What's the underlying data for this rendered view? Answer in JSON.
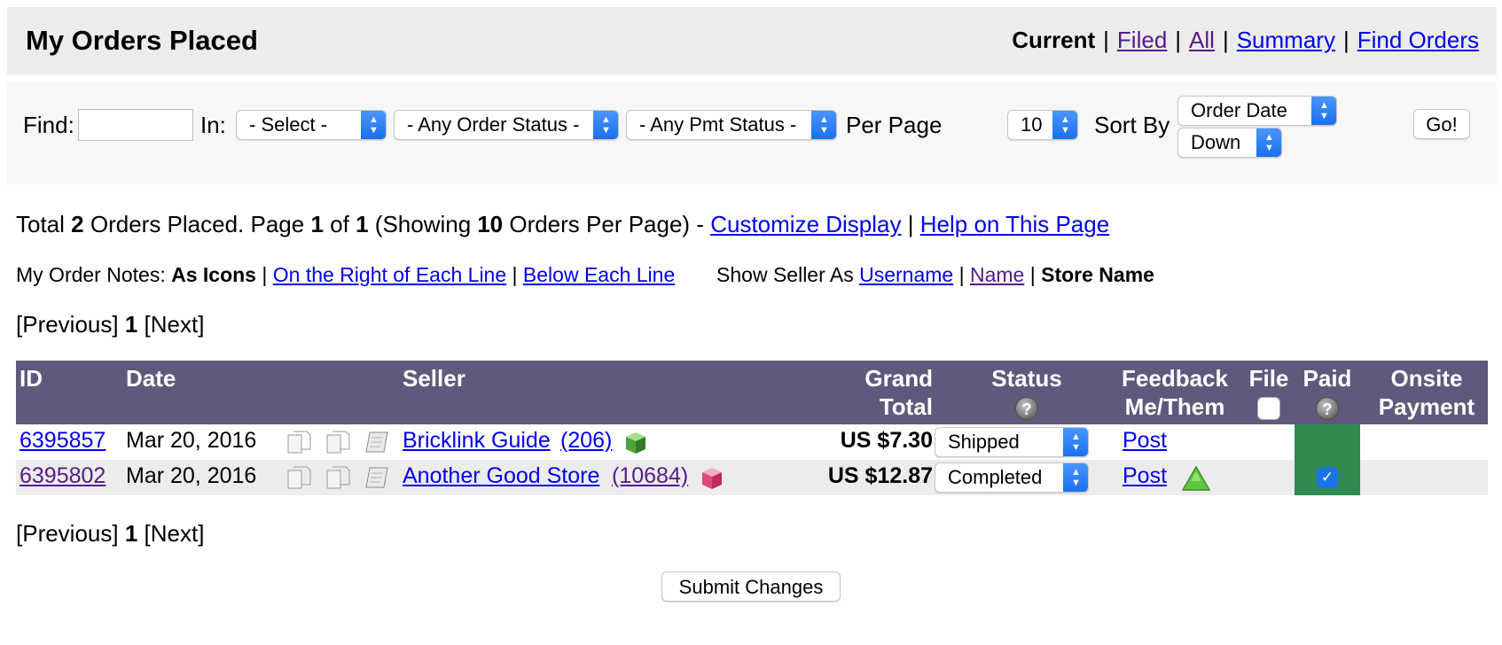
{
  "header": {
    "title": "My Orders Placed",
    "nav": {
      "current": "Current",
      "filed": "Filed",
      "all": "All",
      "summary": "Summary",
      "find_orders": "Find Orders",
      "separator": "|"
    }
  },
  "filter": {
    "find_label": "Find:",
    "find_value": "",
    "in_label": "In:",
    "in_select": "- Select -",
    "order_status_select": "- Any Order Status -",
    "pmt_status_select": "- Any Pmt Status -",
    "per_page_label": "Per Page",
    "per_page_value": "10",
    "sort_by_label": "Sort By",
    "sort_field": "Order Date",
    "sort_dir": "Down",
    "go_button": "Go!"
  },
  "summary": {
    "total_prefix": "Total",
    "total_count": "2",
    "orders_placed_page": "Orders Placed. Page",
    "page_current": "1",
    "of": "of",
    "page_total": "1",
    "showing_prefix": "(Showing",
    "per_page": "10",
    "showing_suffix": "Orders Per Page) -",
    "customize_link": "Customize Display",
    "separator": "|",
    "help_link": "Help on This Page"
  },
  "notes": {
    "label": "My Order Notes:",
    "as_icons": "As Icons",
    "right_link": "On the Right of Each Line",
    "below_link": "Below Each Line",
    "separator": "|",
    "seller_label": "Show Seller As",
    "username_link": "Username",
    "name_link": "Name",
    "store_name": "Store Name"
  },
  "pager": {
    "previous": "[Previous]",
    "page": "1",
    "next": "[Next]"
  },
  "table": {
    "headers": {
      "id": "ID",
      "date": "Date",
      "seller": "Seller",
      "grand_1": "Grand",
      "grand_2": "Total",
      "status": "Status",
      "feedback_1": "Feedback",
      "feedback_2": "Me/Them",
      "file": "File",
      "paid": "Paid",
      "onsite_1": "Onsite",
      "onsite_2": "Payment",
      "help_glyph": "?"
    },
    "rows": [
      {
        "id": "6395857",
        "date": "Mar 20, 2016",
        "seller": "Bricklink Guide",
        "feedback_count": "(206)",
        "total": "US $7.30",
        "status": "Shipped",
        "feedback_link": "Post",
        "paid": false
      },
      {
        "id": "6395802",
        "date": "Mar 20, 2016",
        "seller": "Another Good Store",
        "feedback_count": "(10684)",
        "total": "US $12.87",
        "status": "Completed",
        "feedback_link": "Post",
        "paid": true
      }
    ]
  },
  "submit_button": "Submit Changes",
  "colors": {
    "table_header": "#5f5a7c",
    "paid_cell": "#2f8a50",
    "link": "#0000ee",
    "visited": "#551a8b"
  }
}
